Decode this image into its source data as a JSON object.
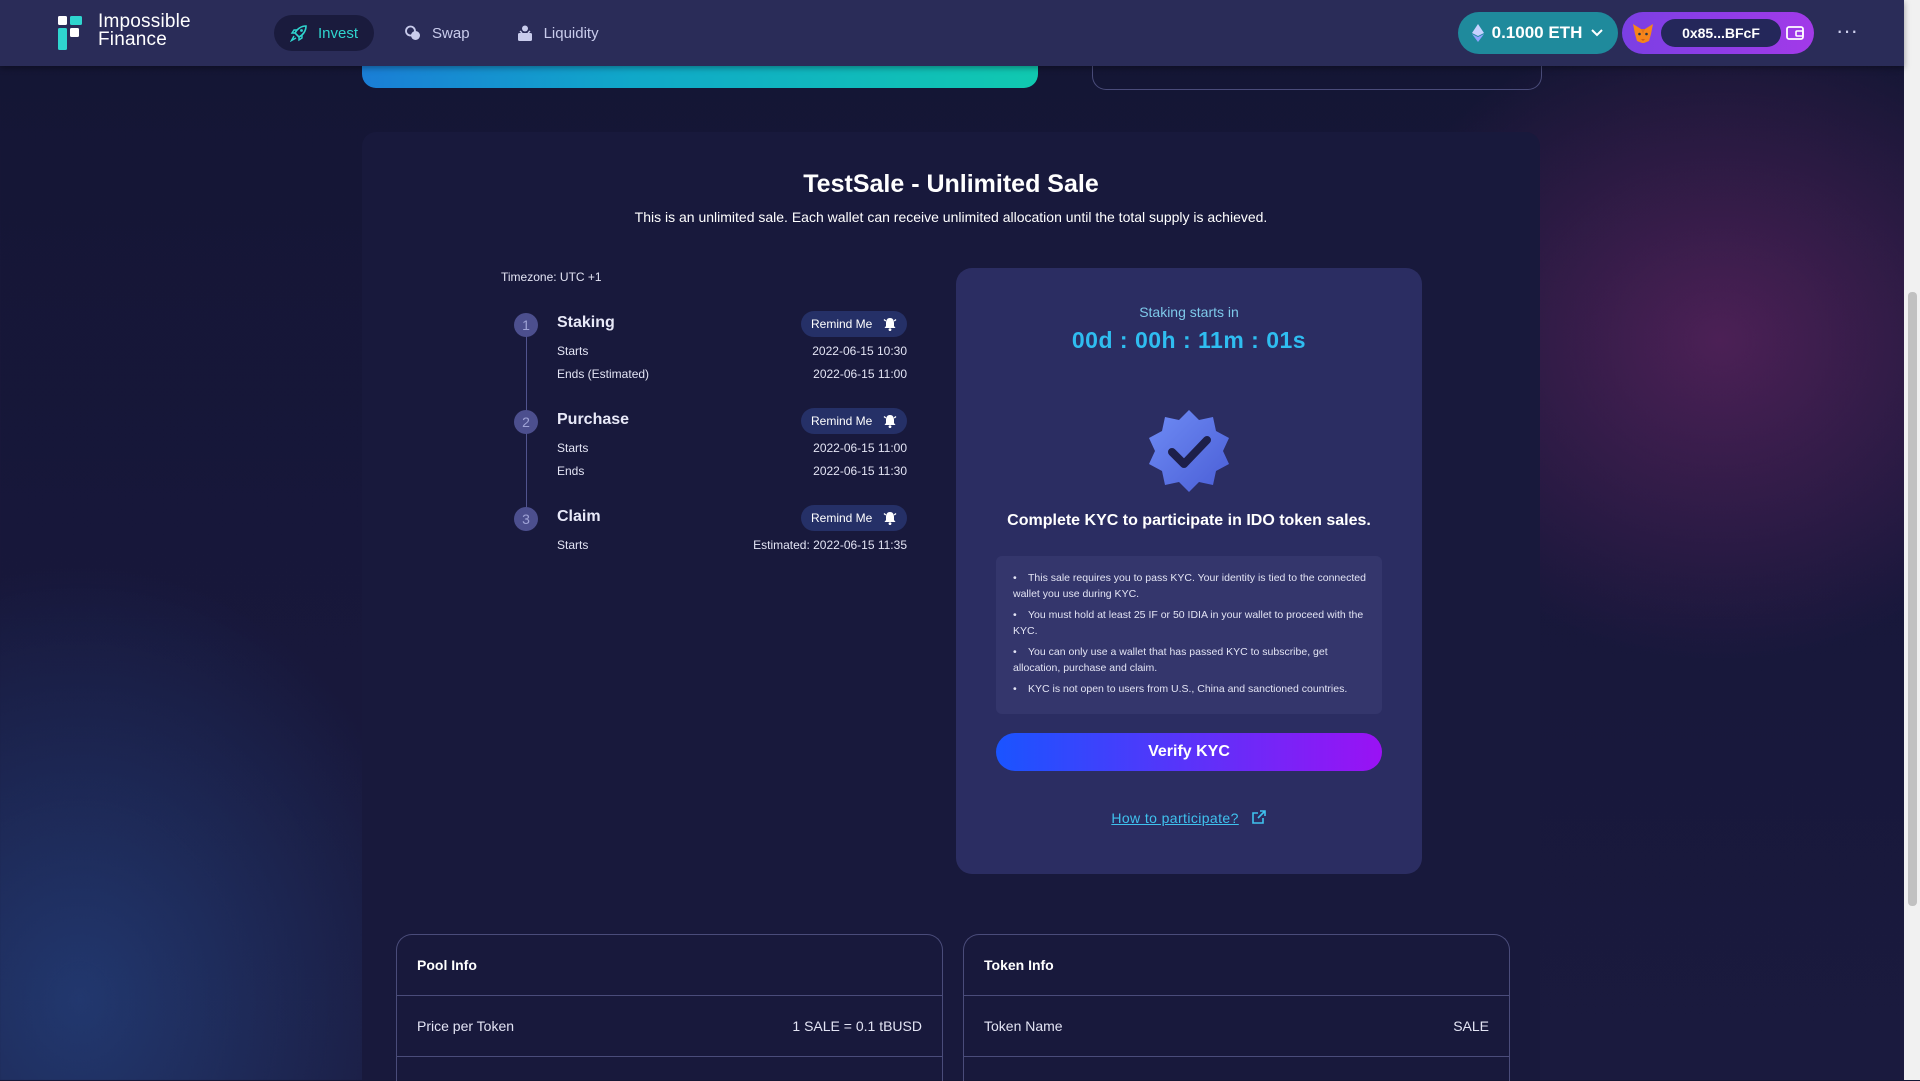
{
  "header": {
    "brand": "Impossible Finance",
    "brand_line1": "Impossible",
    "brand_line2": "Finance",
    "nav": [
      {
        "label": "Invest",
        "icon": "rocket-icon",
        "active": true
      },
      {
        "label": "Swap",
        "icon": "swap-icon",
        "active": false
      },
      {
        "label": "Liquidity",
        "icon": "liquidity-icon",
        "active": false
      }
    ],
    "balance": "0.1000 ETH",
    "wallet_address": "0x85...BFcF",
    "more": "···"
  },
  "sale": {
    "title": "TestSale - Unlimited Sale",
    "description": "This is an unlimited sale. Each wallet can receive unlimited allocation until the total supply is achieved."
  },
  "timeline": {
    "timezone": "Timezone: UTC +1",
    "remind_label": "Remind Me",
    "steps": [
      {
        "number": "1",
        "title": "Staking",
        "rows": [
          {
            "label": "Starts",
            "value": "2022-06-15 10:30"
          },
          {
            "label": "Ends (Estimated)",
            "value": "2022-06-15 11:00"
          }
        ]
      },
      {
        "number": "2",
        "title": "Purchase",
        "rows": [
          {
            "label": "Starts",
            "value": "2022-06-15 11:00"
          },
          {
            "label": "Ends",
            "value": "2022-06-15 11:30"
          }
        ]
      },
      {
        "number": "3",
        "title": "Claim",
        "rows": [
          {
            "label": "Starts",
            "value": "Estimated: 2022-06-15 11:35"
          }
        ]
      }
    ]
  },
  "kyc": {
    "countdown_label": "Staking starts in",
    "countdown": "00d : 00h : 11m : 01s",
    "heading": "Complete KYC to participate in IDO token sales.",
    "notes": [
      "This sale requires you to pass KYC. Your identity is tied to the connected wallet you use during KYC.",
      "You must hold at least 25 IF or 50 IDIA in your wallet to proceed with the KYC.",
      "You can only use a wallet that has passed KYC to subscribe, get allocation, purchase and claim.",
      "KYC is not open to users from U.S., China and sanctioned countries."
    ],
    "verify_button": "Verify KYC",
    "participate_link": "How to participate?"
  },
  "pool_info": {
    "title": "Pool Info",
    "rows": [
      {
        "label": "Price per Token",
        "value": "1 SALE = 0.1 tBUSD"
      }
    ]
  },
  "token_info": {
    "title": "Token Info",
    "rows": [
      {
        "label": "Token Name",
        "value": "SALE"
      }
    ]
  },
  "colors": {
    "accent_teal": "#2fd5cf",
    "countdown_blue": "#2fbdf0",
    "panel_bg": "#18193c",
    "card_bg": "#2b2d62",
    "verify_gradient_start": "#1a54ff",
    "verify_gradient_end": "#9a12f4"
  }
}
